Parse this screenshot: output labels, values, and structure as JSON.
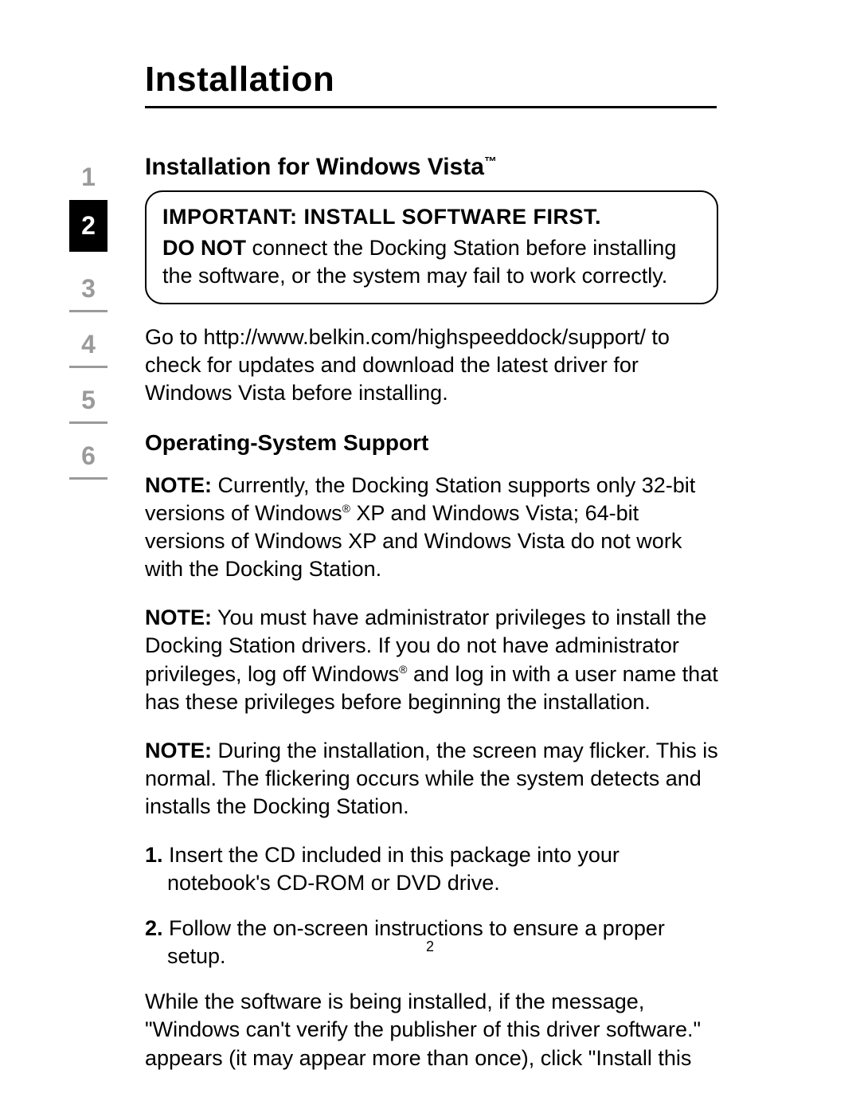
{
  "title": "Installation",
  "sidebar": {
    "items": [
      "1",
      "2",
      "3",
      "4",
      "5",
      "6"
    ],
    "active_index": 1
  },
  "section": {
    "subtitle_main": "Installation for Windows Vista",
    "subtitle_tm": "™",
    "callout": {
      "important": "IMPORTANT: INSTALL SOFTWARE FIRST.",
      "donot_bold": "DO NOT",
      "donot_rest": " connect the Docking Station before installing the software, or the system may fail to work correctly."
    },
    "para_update": "Go to http://www.belkin.com/highspeeddock/support/ to check for updates and download the latest driver for Windows Vista before installing.",
    "h3_os": "Operating-System Support",
    "note1_label": "NOTE:",
    "note1_a": " Currently, the Docking Station supports only 32-bit versions of Windows",
    "note1_reg1": "®",
    "note1_b": " XP and Windows Vista; 64-bit versions of Windows XP and Windows Vista do not work with the Docking Station.",
    "note2_label": "NOTE:",
    "note2_a": " You must have administrator privileges to install the Docking Station drivers. If you do not have administrator privileges, log off Windows",
    "note2_reg": "®",
    "note2_b": " and log in with a user name that has these privileges before beginning the installation.",
    "note3_label": "NOTE:",
    "note3_body": " During the installation, the screen may flicker. This is normal. The flickering occurs while the system detects and installs the Docking Station.",
    "step1_num": "1.",
    "step1_body": " Insert the CD included in this package into your notebook's CD-ROM or DVD drive.",
    "step2_num": "2.",
    "step2_body": " Follow the on-screen instructions to ensure a proper setup.",
    "para_while": "While the software is being installed, if the message, \"Windows can't verify the publisher of this driver software.\" appears (it may appear more than once), click \"Install this"
  },
  "page_number": "2"
}
